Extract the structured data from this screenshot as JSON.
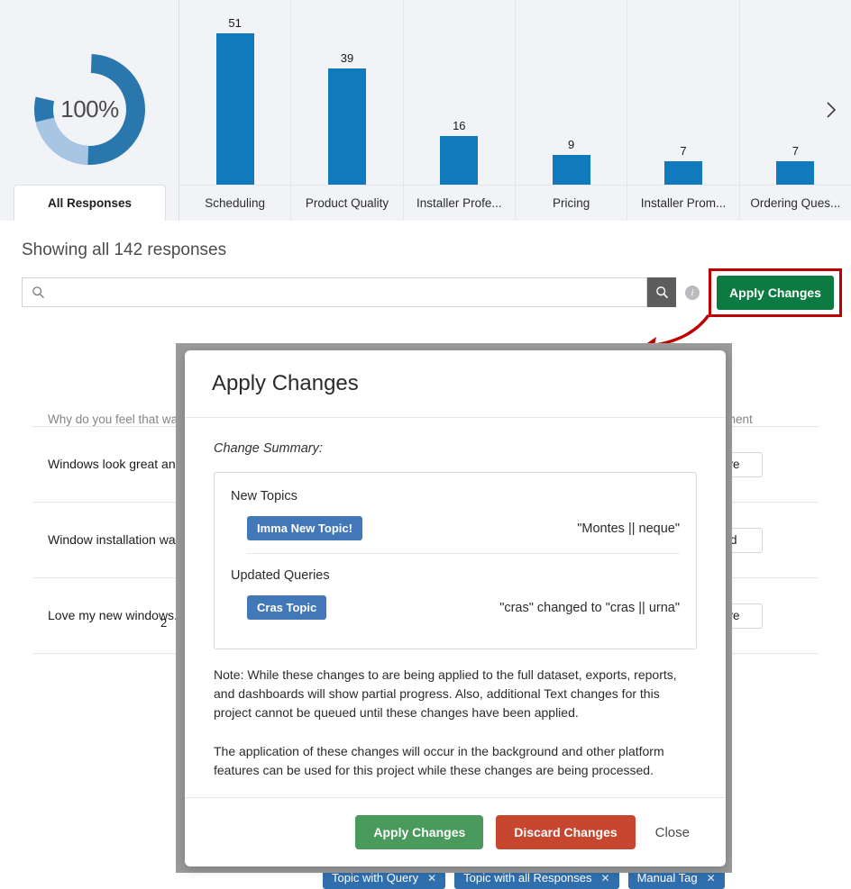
{
  "chart_data": {
    "type": "bar",
    "title": "",
    "xlabel": "",
    "ylabel": "",
    "categories": [
      "Scheduling",
      "Product Quality",
      "Installer Profe...",
      "Pricing",
      "Installer Prom...",
      "Ordering Ques..."
    ],
    "values": [
      51,
      39,
      16,
      9,
      7,
      7
    ],
    "ylim": [
      0,
      51
    ],
    "grid": false,
    "legend": "none",
    "bar_color": "#1279bd",
    "donut": {
      "center_label": "100%",
      "segments": [
        {
          "name": "primary",
          "percent": 78,
          "color": "#2a77ae"
        },
        {
          "name": "secondary",
          "percent": 22,
          "color": "#a8c6e3"
        }
      ]
    }
  },
  "tabs": {
    "selected": "All Responses",
    "scroll_next_icon": "chevron-right-icon"
  },
  "toolbar": {
    "showing_text": "Showing all 142 responses",
    "search_placeholder": "",
    "search_value": "",
    "search_icon": "search-icon",
    "search_button_icon": "search-icon",
    "info_icon": "info-icon",
    "apply_changes_label": "Apply Changes",
    "highlight_color": "#c00000",
    "apply_button_color": "#0c7a41"
  },
  "table": {
    "headers": [
      "Why do you feel that way?",
      "Sentiment"
    ],
    "rows": [
      {
        "text": "Windows look great and",
        "sentiment": "tive",
        "count": ""
      },
      {
        "text": "Window installation was\nand appearance",
        "sentiment": "ed",
        "count": ""
      },
      {
        "text": "Love my new windows. T",
        "sentiment": "tive",
        "count": "2"
      }
    ]
  },
  "topic_tags": [
    {
      "label": "Topic with Query",
      "remove_icon": "close-icon"
    },
    {
      "label": "Topic with all Responses",
      "remove_icon": "close-icon"
    },
    {
      "label": "Manual Tag",
      "remove_icon": "close-icon"
    }
  ],
  "modal": {
    "title": "Apply Changes",
    "change_summary_label": "Change Summary:",
    "sections": [
      {
        "title": "New Topics",
        "chip": "Imma New Topic!",
        "change": "\"Montes || neque\""
      },
      {
        "title": "Updated Queries",
        "chip": "Cras Topic",
        "change": "\"cras\" changed to \"cras || urna\""
      }
    ],
    "note1": "Note: While these changes to are being applied to the full dataset, exports, reports, and dashboards will show partial progress. Also, additional Text changes for this project cannot be queued until these changes have been applied.",
    "note2": "The application of these changes will occur in the background and other platform features can be used for this project while these changes are being processed.",
    "buttons": {
      "apply": "Apply Changes",
      "discard": "Discard Changes",
      "close": "Close"
    }
  }
}
